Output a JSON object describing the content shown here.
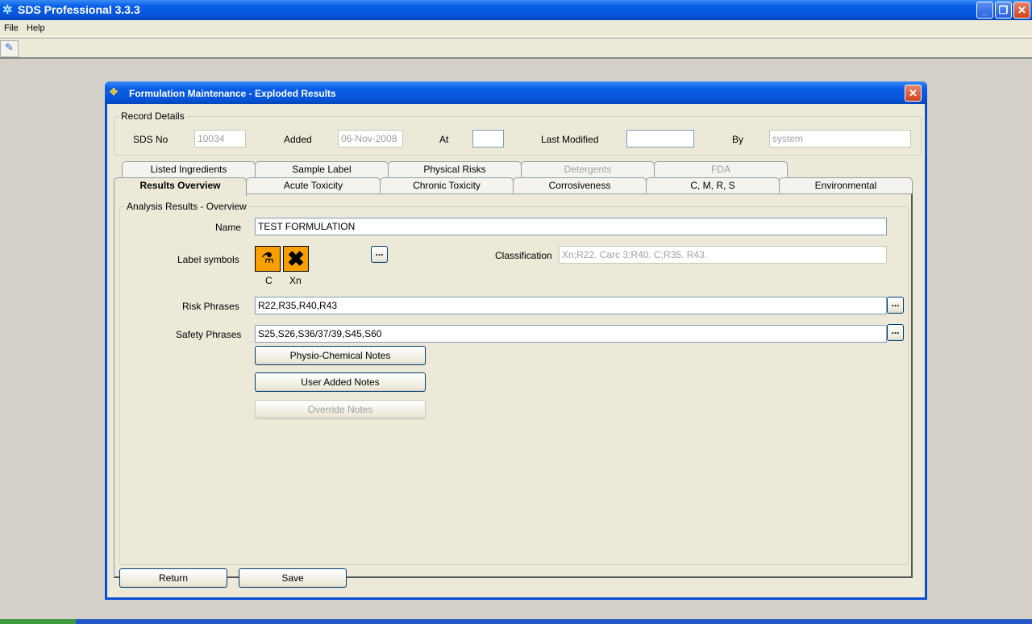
{
  "app": {
    "title": "SDS Professional 3.3.3",
    "menu": [
      "File",
      "Help"
    ]
  },
  "dialog": {
    "title": "Formulation Maintenance - Exploded Results"
  },
  "record": {
    "group_title": "Record Details",
    "sds_no_label": "SDS No",
    "sds_no": "10034",
    "added_label": "Added",
    "added": "06-Nov-2008",
    "at_label": "At",
    "at": "",
    "last_modified_label": "Last Modified",
    "last_modified": "",
    "by_label": "By",
    "by": "system"
  },
  "tabs_row1": [
    {
      "label": "Listed Ingredients",
      "enabled": true
    },
    {
      "label": "Sample Label",
      "enabled": true
    },
    {
      "label": "Physical Risks",
      "enabled": true
    },
    {
      "label": "Detergents",
      "enabled": false
    },
    {
      "label": "FDA",
      "enabled": false
    }
  ],
  "tabs_row2": [
    {
      "label": "Results Overview",
      "selected": true
    },
    {
      "label": "Acute Toxicity"
    },
    {
      "label": "Chronic Toxicity"
    },
    {
      "label": "Corrosiveness"
    },
    {
      "label": "C, M, R, S"
    },
    {
      "label": "Environmental"
    }
  ],
  "overview": {
    "group_title": "Analysis Results - Overview",
    "name_label": "Name",
    "name": "TEST FORMULATION",
    "label_symbols_label": "Label symbols",
    "symbols": [
      {
        "code": "C",
        "icon": "corrosive-icon"
      },
      {
        "code": "Xn",
        "icon": "harmful-x-icon"
      }
    ],
    "ellipsis": "...",
    "classification_label": "Classification",
    "classification": "Xn;R22. Carc 3;R40. C;R35. R43.",
    "risk_label": "Risk Phrases",
    "risk": "R22,R35,R40,R43",
    "safety_label": "Safety Phrases",
    "safety": "S25,S26,S36/37/39,S45,S60",
    "physio_btn": "Physio-Chemical Notes",
    "user_notes_btn": "User Added Notes",
    "override_btn": "Override Notes"
  },
  "footer": {
    "return": "Return",
    "save": "Save"
  },
  "colors": {
    "hazard_orange": "#f7a000",
    "title_blue": "#0a5fe6"
  }
}
